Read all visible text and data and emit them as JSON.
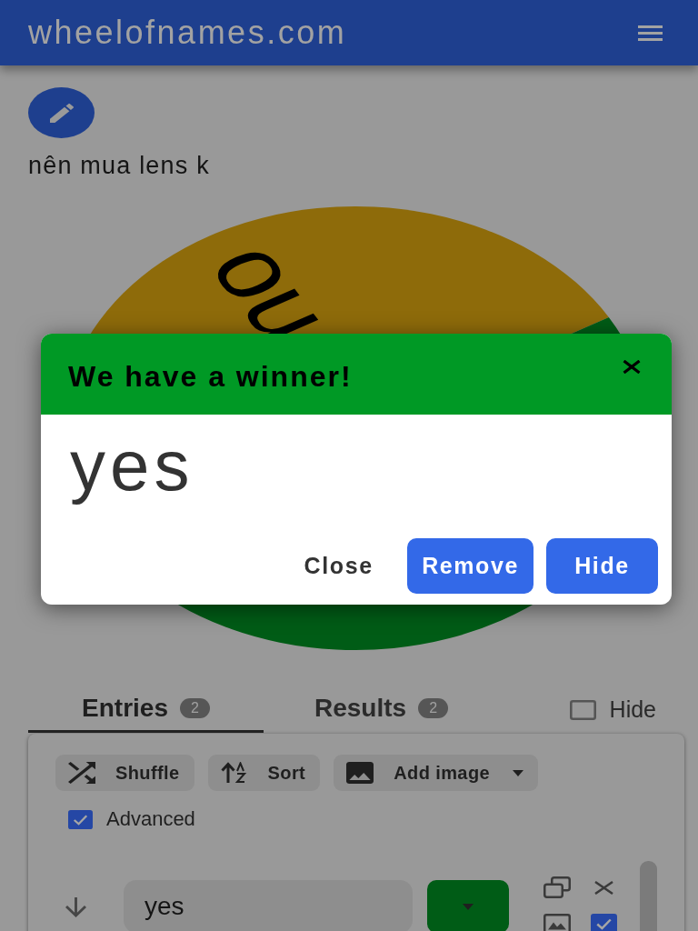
{
  "header": {
    "title": "wheelofnames.com"
  },
  "wheel_title": "nên mua lens k",
  "wheel": {
    "slices": [
      {
        "label": "no",
        "color": "#8e6b0a"
      },
      {
        "color": "#005c16"
      }
    ]
  },
  "tabs": [
    {
      "label": "Entries",
      "count": "2",
      "selected": true
    },
    {
      "label": "Results",
      "count": "2",
      "selected": false
    }
  ],
  "hide_toggle": {
    "label": "Hide",
    "checked": false
  },
  "toolbar": [
    {
      "kind": "shuffle",
      "label": "Shuffle",
      "dropdown": false
    },
    {
      "kind": "sort",
      "label": "Sort",
      "dropdown": false
    },
    {
      "kind": "image",
      "label": "Add image",
      "dropdown": true
    }
  ],
  "advanced": {
    "label": "Advanced",
    "checked": true
  },
  "entries": [
    {
      "text": "yes",
      "color": "#005c16",
      "checked": true
    }
  ],
  "dialog": {
    "title": "We have a winner!",
    "winner": "yes",
    "buttons": [
      {
        "kind": "text",
        "label": "Close"
      },
      {
        "kind": "primary",
        "label": "Remove"
      },
      {
        "kind": "primary",
        "label": "Hide"
      }
    ]
  }
}
